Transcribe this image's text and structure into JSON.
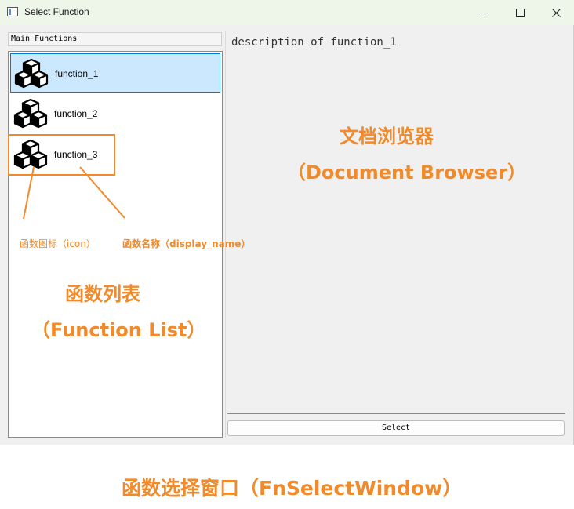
{
  "window": {
    "title": "Select Function",
    "app_icon": "window-icon",
    "controls": [
      "minimize-icon",
      "maximize-icon",
      "close-icon"
    ]
  },
  "list": {
    "header": "Main Functions",
    "items": [
      {
        "label": "function_1",
        "icon": "cubes-icon",
        "selected": true
      },
      {
        "label": "function_2",
        "icon": "cubes-icon",
        "selected": false
      },
      {
        "label": "function_3",
        "icon": "cubes-icon",
        "selected": false
      }
    ]
  },
  "document": {
    "text": "description of function_1"
  },
  "select_button": {
    "label": "Select"
  },
  "annotations": {
    "doc_browser_cn": "文档浏览器",
    "doc_browser_en": "（Document Browser）",
    "function_list_cn": "函数列表",
    "function_list_en": "（Function List）",
    "icon_label": "函数图标（icon）",
    "name_label": "函数名称（display_name）",
    "window_label": "函数选择窗口（FnSelectWindow）"
  },
  "colors": {
    "annotation": "#f08a2a",
    "selection_bg": "#cce8ff",
    "selection_border": "#0078d7",
    "titlebar": "#eef5e9"
  }
}
